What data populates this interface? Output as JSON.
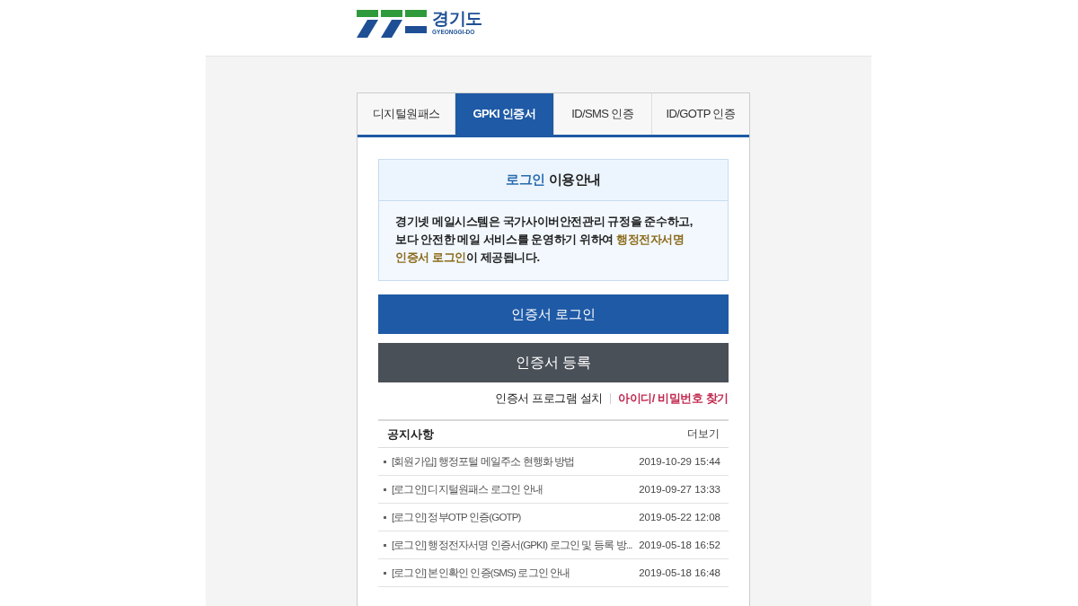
{
  "header": {
    "logo_text": "경기도",
    "logo_subtext": "GYEONGGI-DO"
  },
  "tabs": [
    {
      "label": "디지털원패스",
      "selected": false
    },
    {
      "label": "GPKI 인증서",
      "selected": true
    },
    {
      "label": "ID/SMS 인증",
      "selected": false
    },
    {
      "label": "ID/GOTP 인증",
      "selected": false
    }
  ],
  "info": {
    "title": [
      {
        "text": "로그인",
        "kind": "accent"
      },
      {
        "text": " 이용안내",
        "kind": "plain"
      }
    ],
    "body_lines": [
      [
        {
          "text": "경기넷 메일시스템은 국가사이버안전관리 규정을 준수하고,",
          "kind": "plain"
        }
      ],
      [
        {
          "text": "보다 안전한 메일 서비스를 운영하기 위하여 ",
          "kind": "plain"
        },
        {
          "text": "행정전자서명",
          "kind": "highlight"
        }
      ],
      [
        {
          "text": "인증서 로그인",
          "kind": "highlight"
        },
        {
          "text": "이 제공됩니다.",
          "kind": "plain"
        }
      ]
    ]
  },
  "buttons": [
    {
      "label": "인증서 로그인",
      "kind": "primary"
    },
    {
      "label": "인증서 등록",
      "kind": "secondary"
    }
  ],
  "links": [
    {
      "label": "인증서 프로그램 설치",
      "kind": "plain"
    },
    {
      "label": "아이디/ 비밀번호 찾기",
      "kind": "accent"
    }
  ],
  "notices": {
    "title": "공지사항",
    "more": "더보기",
    "rows": [
      {
        "title": "[회원가입] 행정포털 메일주소 현행화 방법",
        "date": "2019-10-29 15:44"
      },
      {
        "title": "[로그인] 디지털원패스 로그인 안내",
        "date": "2019-09-27 13:33"
      },
      {
        "title": "[로그인] 정부OTP 인증(GOTP)",
        "date": "2019-05-22 12:08"
      },
      {
        "title": "[로그인] 행정전자서명 인증서(GPKI) 로그인 및 등록 방...",
        "date": "2019-05-18 16:52"
      },
      {
        "title": "[로그인] 본인확인 인증(SMS) 로그인 안내",
        "date": "2019-05-18 16:48"
      }
    ]
  }
}
